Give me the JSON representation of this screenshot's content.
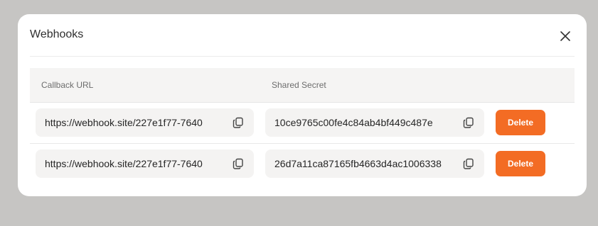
{
  "modal": {
    "title": "Webhooks",
    "close_icon": "close-icon"
  },
  "table": {
    "headers": {
      "callback_url": "Callback URL",
      "shared_secret": "Shared Secret"
    },
    "rows": [
      {
        "callback_url": "https://webhook.site/227e1f77-7640",
        "shared_secret": "10ce9765c00fe4c84ab4bf449c487e",
        "delete_label": "Delete"
      },
      {
        "callback_url": "https://webhook.site/227e1f77-7640",
        "shared_secret": "26d7a11ca87165fb4663d4ac1006338",
        "delete_label": "Delete"
      }
    ],
    "copy_icon": "copy-icon"
  },
  "colors": {
    "accent": "#f36c24",
    "backdrop": "#c6c5c3",
    "header_bg": "#f5f4f3",
    "field_bg": "#f4f3f2"
  }
}
